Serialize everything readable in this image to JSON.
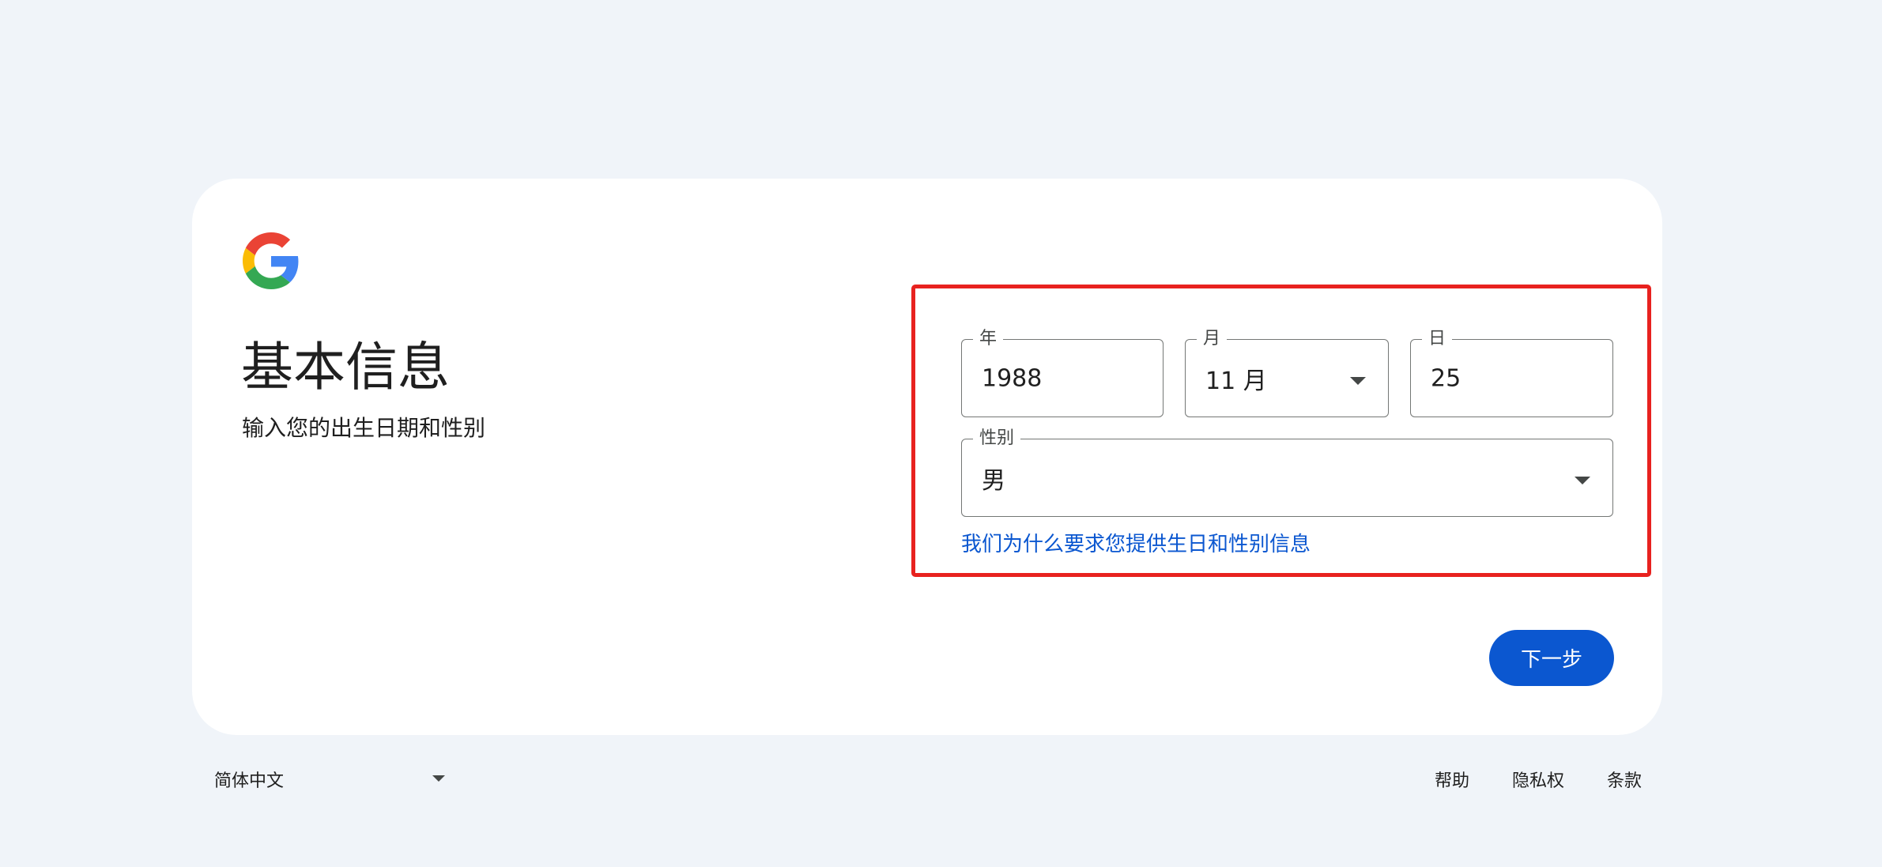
{
  "card": {
    "title": "基本信息",
    "subtitle": "输入您的出生日期和性别"
  },
  "form": {
    "year": {
      "label": "年",
      "value": "1988"
    },
    "month": {
      "label": "月",
      "value": "11 月"
    },
    "day": {
      "label": "日",
      "value": "25"
    },
    "gender": {
      "label": "性别",
      "value": "男"
    },
    "why_link": "我们为什么要求您提供生日和性别信息"
  },
  "actions": {
    "next_label": "下一步"
  },
  "footer": {
    "language": "简体中文",
    "links": {
      "help": "帮助",
      "privacy": "隐私权",
      "terms": "条款"
    }
  },
  "colors": {
    "page_bg": "#f0f4f9",
    "card_bg": "#ffffff",
    "accent": "#0b57d0",
    "highlight": "#e8221f"
  },
  "icons": {
    "logo": "google-g-logo",
    "dropdown": "caret-down-icon"
  }
}
